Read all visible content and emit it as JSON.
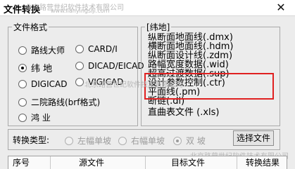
{
  "window": {
    "title": "文件转换",
    "close_symbol": "✕"
  },
  "watermark": {
    "line1": "北京路营世纪软件技术有限公司",
    "line2": "www.lianyingsiji.com",
    "line3": "北京路营世纪软件技术有限公司",
    "line4": "北京路营世纪软件技术有限公司"
  },
  "file_format": {
    "label": "文件格式",
    "options": [
      {
        "label": "路线大师",
        "checked": false
      },
      {
        "label": "CARD/I",
        "checked": false
      },
      {
        "label": "纬 地",
        "checked": true
      },
      {
        "label": "DICAD/EICAD",
        "checked": false
      },
      {
        "label": "DIGICAD",
        "checked": false
      },
      {
        "label": "VIGICAD",
        "checked": false
      },
      {
        "label": "二院路线(brf格式)",
        "checked": false
      },
      {
        "label": "鸿 业",
        "checked": false
      }
    ]
  },
  "weidi_panel": {
    "label": "[纬地]",
    "items": [
      "纵断面地面线(.dmx)",
      "横断面地面线(.hdm)",
      "纵断面设计线(.zdm)",
      "路幅宽度数据(.wid)",
      "超高过渡数据(.sup)",
      "设计参数控制(.ctr)",
      "平面线(.pm)",
      "断链(.dl)",
      "直曲表文件  (.xls)"
    ]
  },
  "conversion_type": {
    "label": "转换类型:",
    "options": [
      {
        "label": "左幅单坡",
        "checked": false,
        "enabled": false
      },
      {
        "label": "右幅单坡",
        "checked": false,
        "enabled": false
      },
      {
        "label": "双  坡",
        "checked": true,
        "enabled": false
      }
    ],
    "select_file_button": "选择文件"
  },
  "table": {
    "columns": [
      "序号",
      "源文件",
      "目标文件",
      "转换结果"
    ]
  },
  "colors": {
    "highlight": "#e02020",
    "dialog_bg": "#ececec"
  }
}
